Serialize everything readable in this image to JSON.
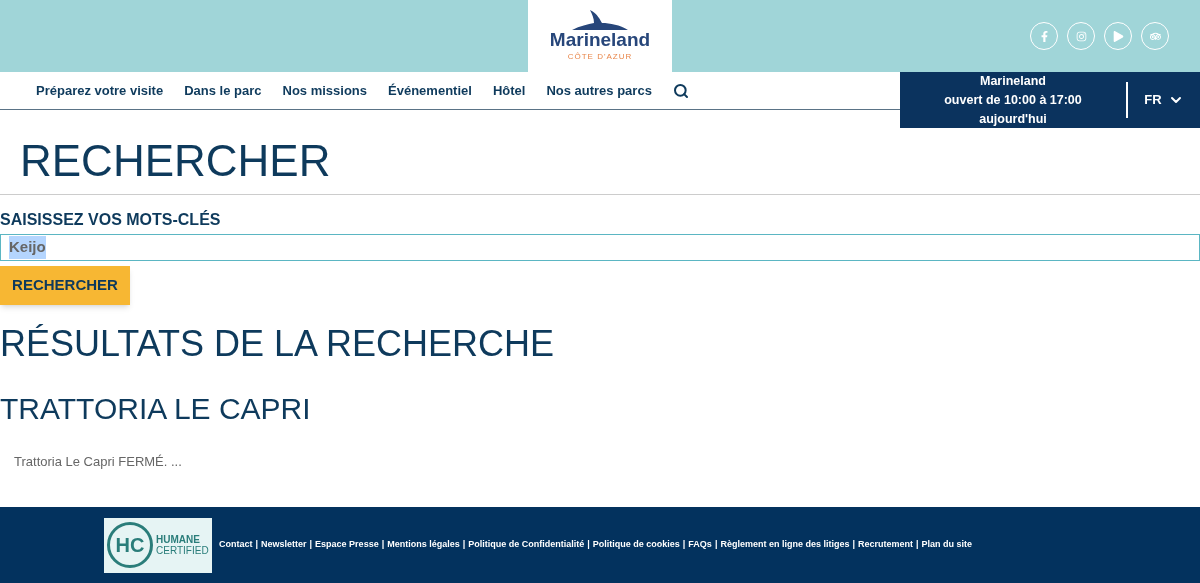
{
  "logo": {
    "name": "Marineland",
    "tagline": "CÔTE D'AZUR"
  },
  "social": [
    {
      "kind": "facebook"
    },
    {
      "kind": "instagram"
    },
    {
      "kind": "youtube"
    },
    {
      "kind": "tripadvisor"
    }
  ],
  "nav": {
    "items": [
      "Préparez votre visite",
      "Dans le parc",
      "Nos missions",
      "Événementiel",
      "Hôtel",
      "Nos autres parcs"
    ]
  },
  "hours": {
    "lines": [
      "Marineland",
      "ouvert de 10:00 à 17:00",
      "aujourd'hui"
    ]
  },
  "language": "FR",
  "page_title": "RECHERCHER",
  "search": {
    "label": "SAISISSEZ VOS MOTS-CLÉS",
    "value": "Keijo",
    "button": "RECHERCHER"
  },
  "results_title": "RÉSULTATS DE LA RECHERCHE",
  "results": [
    {
      "title": "TRATTORIA LE CAPRI",
      "excerpt": "Trattoria Le Capri FERMÉ. ..."
    }
  ],
  "footer": {
    "badge": {
      "mark": "HC",
      "line_1": "HUMANE",
      "line_2": "CERTIFIED"
    },
    "separator": "|",
    "links": [
      "Contact",
      "Newsletter",
      "Espace Presse",
      "Mentions légales",
      "Politique de Confidentialité",
      "Politique de cookies",
      "FAQs",
      "Règlement en ligne des litiges",
      "Recrutement",
      "Plan du site"
    ]
  }
}
